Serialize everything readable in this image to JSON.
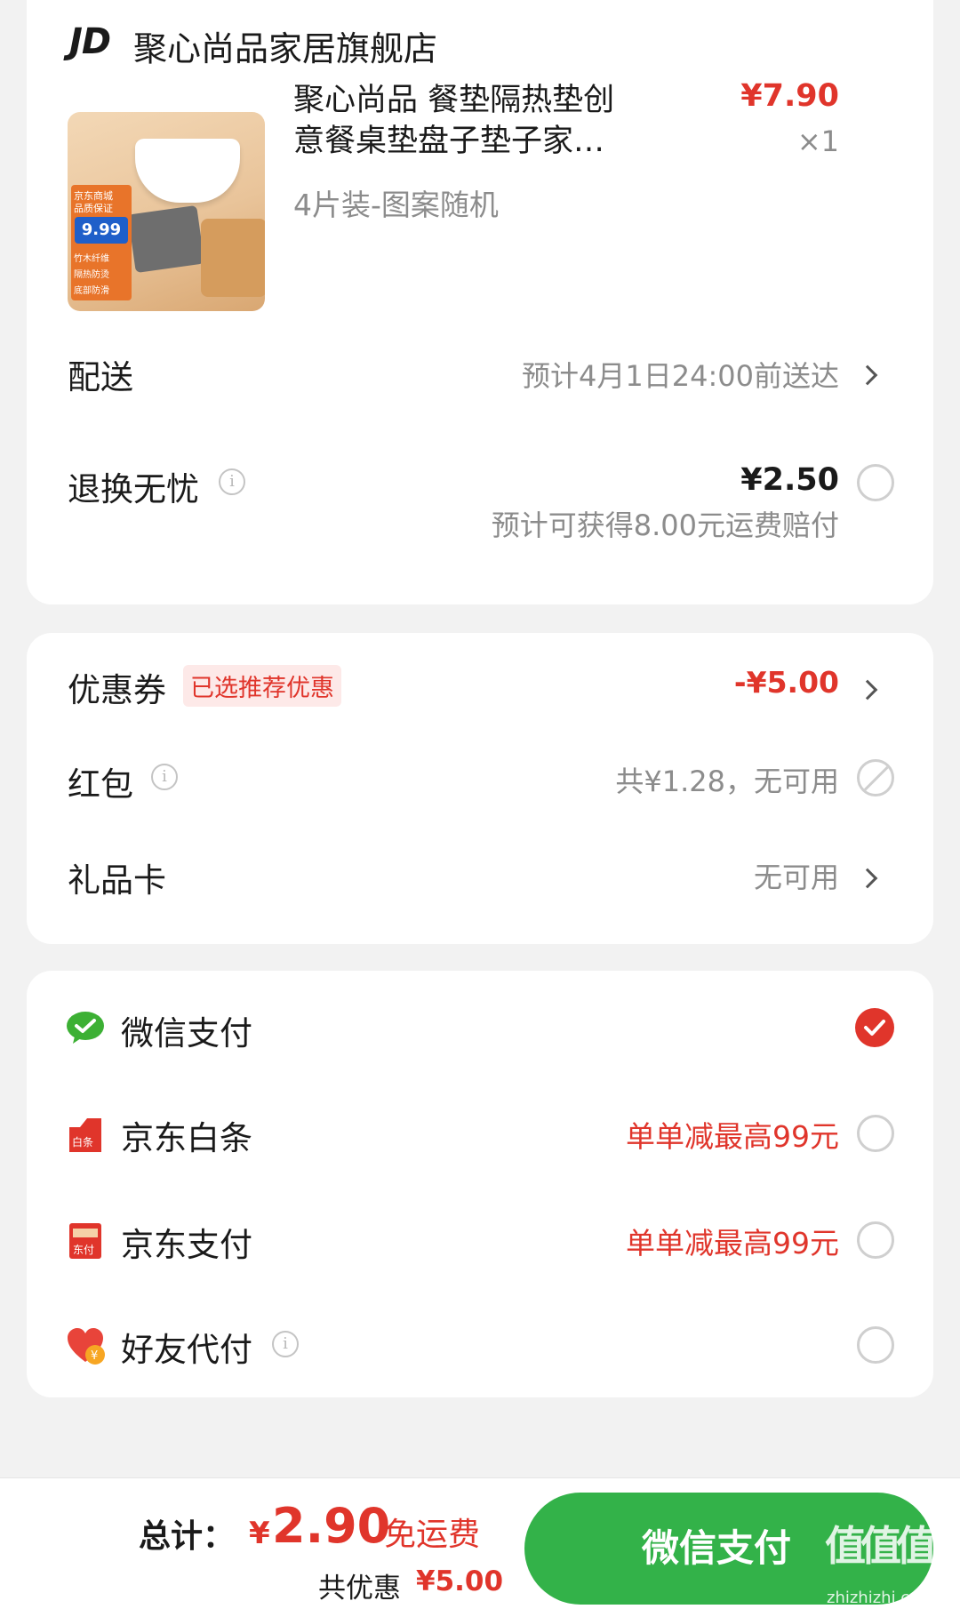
{
  "store": {
    "logo_text": "JD",
    "name": "聚心尚品家居旗舰店"
  },
  "product": {
    "title_line1": "聚心尚品 餐垫隔热垫创",
    "title_line2": "意餐桌垫盘子垫子家…",
    "variant": "4片装-图案随机",
    "price": "¥7.90",
    "quantity": "×1",
    "image_tags": [
      "京东商城",
      "品质保证",
      "9.99",
      "竹木纤维",
      "隔热防烫",
      "底部防滑"
    ]
  },
  "delivery": {
    "label": "配送",
    "value": "预计4月1日24:00前送达"
  },
  "return_insurance": {
    "label": "退换无忧",
    "price": "¥2.50",
    "note": "预计可获得8.00元运费赔付"
  },
  "coupon": {
    "label": "优惠券",
    "badge": "已选推荐优惠",
    "value": "-¥5.00"
  },
  "red_packet": {
    "label": "红包",
    "value": "共¥1.28，无可用"
  },
  "gift_card": {
    "label": "礼品卡",
    "value": "无可用"
  },
  "payment_methods": [
    {
      "name": "微信支付",
      "promo": "",
      "selected": true,
      "icon": "wechat-icon"
    },
    {
      "name": "京东白条",
      "promo": "单单减最高99元",
      "selected": false,
      "icon": "baitiao-icon"
    },
    {
      "name": "京东支付",
      "promo": "单单减最高99元",
      "selected": false,
      "icon": "jd-pay-icon"
    },
    {
      "name": "好友代付",
      "promo": "",
      "selected": false,
      "icon": "friend-pay-icon"
    }
  ],
  "footer": {
    "total_label": "总计：",
    "total_currency": "¥",
    "total_value": "2.90",
    "shipping": "免运费",
    "discount_label": "共优惠",
    "discount_value": "¥5.00",
    "pay_button": "微信支付"
  },
  "watermark": {
    "text": "值值值",
    "url": "zhizhizhi.com"
  },
  "colors": {
    "accent_red": "#e0352b",
    "pay_green": "#33b249",
    "wechat_green": "#3cb034"
  }
}
